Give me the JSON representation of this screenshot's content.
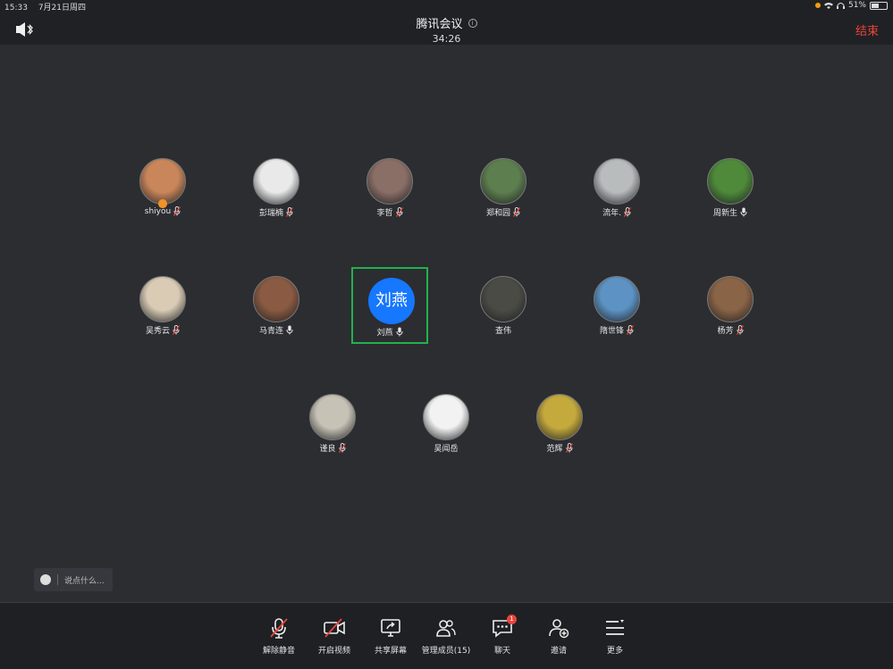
{
  "status_bar": {
    "time": "15:33",
    "date": "7月21日周四",
    "battery": "51%",
    "battery_level": 0.51
  },
  "header": {
    "title": "腾讯会议",
    "timer": "34:26",
    "end_label": "结束"
  },
  "participants": [
    {
      "name": "shiyou",
      "avatar_color": "#c9865a",
      "mic": "muted"
    },
    {
      "name": "彭瑞楠",
      "avatar_color": "#e9e9e9",
      "mic": "muted"
    },
    {
      "name": "李哲",
      "avatar_color": "#8a6f66",
      "mic": "muted"
    },
    {
      "name": "郑和园",
      "avatar_color": "#5d7f4f",
      "mic": "muted"
    },
    {
      "name": "流年.",
      "avatar_color": "#b8bcbc",
      "mic": "muted"
    },
    {
      "name": "周新生",
      "avatar_color": "#4e8a3a",
      "mic": "on"
    },
    {
      "name": "吴秀云",
      "avatar_color": "#d9cbb4",
      "mic": "muted"
    },
    {
      "name": "马青连",
      "avatar_color": "#8a5a42",
      "mic": "on"
    },
    {
      "name": "刘燕",
      "avatar_text": "刘燕",
      "avatar_color": "#1677ff",
      "mic": "on"
    },
    {
      "name": "查伟",
      "avatar_color": "#4b4b45",
      "mic": "none"
    },
    {
      "name": "隋世锋",
      "avatar_color": "#5d93c4",
      "mic": "muted"
    },
    {
      "name": "杨芳",
      "avatar_color": "#8a6446",
      "mic": "muted"
    },
    {
      "name": "谨良",
      "avatar_color": "#c7c2b6",
      "mic": "muted"
    },
    {
      "name": "吴闻岳",
      "avatar_color": "#f2f2f2",
      "mic": "none"
    },
    {
      "name": "范辉",
      "avatar_color": "#c4a93c",
      "mic": "muted"
    }
  ],
  "chat": {
    "placeholder": "说点什么..."
  },
  "toolbar": {
    "unmute": "解除静音",
    "video": "开启视频",
    "share": "共享屏幕",
    "members": "管理成员(15)",
    "chat": "聊天",
    "chat_badge": "1",
    "invite": "邀请",
    "more": "更多"
  },
  "colors": {
    "accent_end": "#e8453c",
    "selected_border": "#22b14c",
    "background": "#2b2d31"
  }
}
